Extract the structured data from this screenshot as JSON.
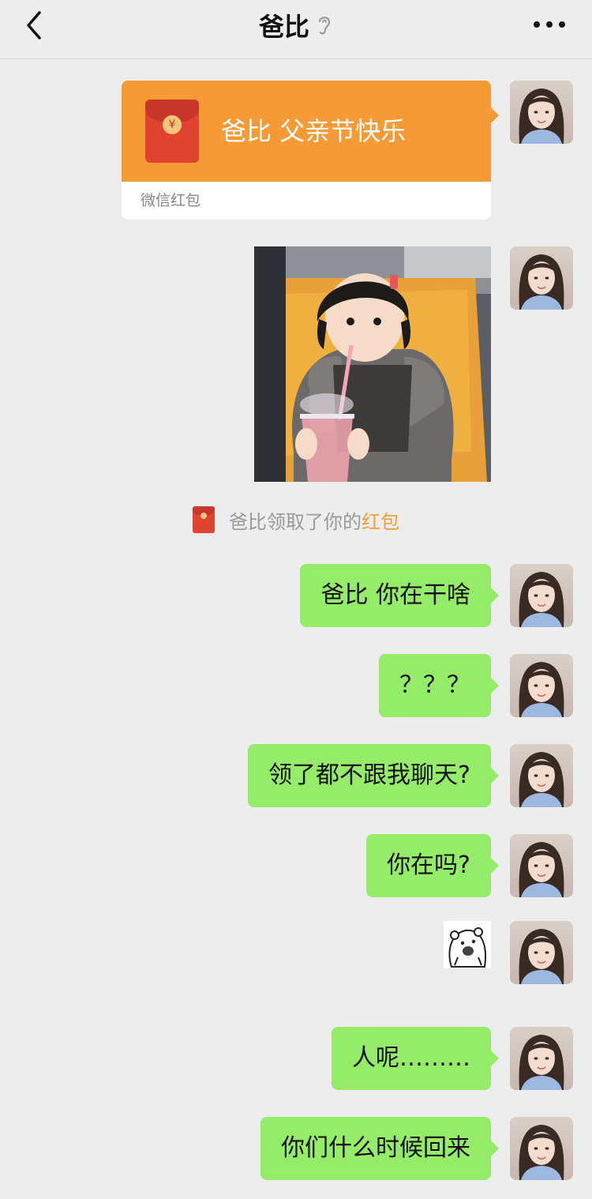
{
  "header": {
    "title": "爸比",
    "back_icon": "chevron-left-icon",
    "muted_icon": "ear-icon",
    "more_icon": "ellipsis-icon"
  },
  "messages": {
    "red_packet": {
      "greeting": "爸比 父亲节快乐",
      "label": "微信红包",
      "color": "#f69a35"
    },
    "notice": {
      "prefix": "爸比领取了你的",
      "link": "红包"
    },
    "bubbles": [
      "爸比 你在干啥",
      "？？？",
      "领了都不跟我聊天?",
      "你在吗?",
      "人呢………",
      "你们什么时候回来"
    ],
    "bubble_color": "#95ec69"
  }
}
